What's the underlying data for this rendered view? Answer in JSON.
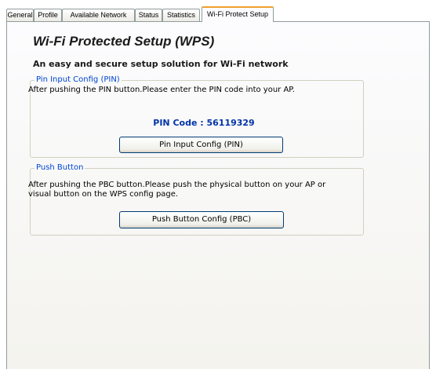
{
  "tabs": [
    {
      "label": "General"
    },
    {
      "label": "Profile"
    },
    {
      "label": "Available Network"
    },
    {
      "label": "Status"
    },
    {
      "label": "Statistics"
    },
    {
      "label": "Wi-Fi Protect Setup",
      "active": true
    }
  ],
  "wps": {
    "title": "Wi-Fi Protected Setup (WPS)",
    "subtitle": "An easy and secure setup solution for Wi-Fi network",
    "pin_group": {
      "legend": "Pin Input Config (PIN)",
      "description": "After pushing the PIN button.Please enter the PIN code into your AP.",
      "pin_label": "PIN Code : ",
      "pin_value": "56119329",
      "button_label": "Pin Input Config (PIN)"
    },
    "push_group": {
      "legend": "Push Button",
      "description": "After pushing the PBC button.Please push the physical button on your AP or visual button on the WPS config page.",
      "button_label": "Push Button Config (PBC)"
    }
  },
  "colors": {
    "legend": "#0046d5",
    "pin_code": "#0033aa",
    "active_tab_accent": "#f0a030"
  }
}
